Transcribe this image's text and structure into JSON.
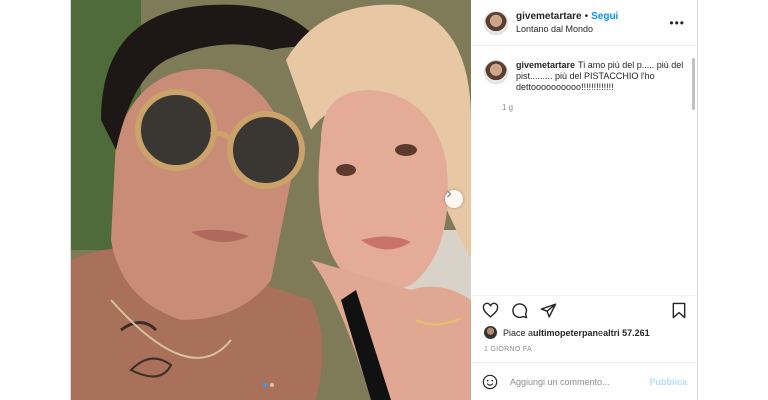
{
  "post": {
    "username": "givemetartare",
    "separator": "•",
    "follow_label": "Segui",
    "location": "Lontano dal Mondo",
    "more_label": "•••"
  },
  "caption": {
    "username": "givemetartare",
    "text": "Ti amo più del p..... più del pist......... più del PISTACCHIO l'ho dettoooooooooo!!!!!!!!!!!!!",
    "time": "1 g"
  },
  "likes": {
    "prefix": "Piace a ",
    "user": "ultimopeterpan",
    "middle": " e ",
    "count": "altri 57.261"
  },
  "date": "1 GIORNO FA",
  "comment": {
    "placeholder": "Aggiungi un commento...",
    "publish_label": "Pubblica"
  },
  "carousel": {
    "slides": 2,
    "current": 1
  },
  "colors": {
    "accent": "#0095f6",
    "publish_disabled": "#b2dffc",
    "carousel_active_dot": "#3897f0"
  },
  "icons": [
    "heart-icon",
    "comment-icon",
    "share-icon",
    "bookmark-icon",
    "emoji-icon",
    "chevron-right-icon",
    "more-icon"
  ]
}
